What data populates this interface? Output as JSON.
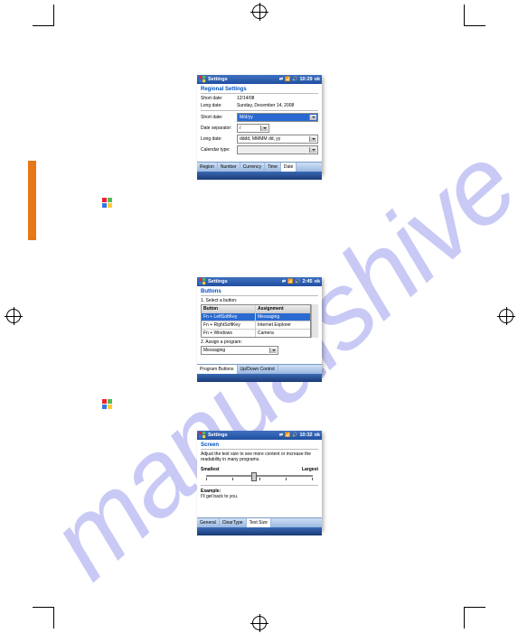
{
  "watermark": "manualshive.com",
  "screenshots": {
    "regional": {
      "title": "Settings",
      "time": "10:29",
      "ok": "ok",
      "panel": "Regional Settings",
      "shortDateLabel": "Short date:",
      "shortDateVal": "12/14/08",
      "longDateLabel": "Long date:",
      "longDateVal": "Sunday, December 14, 2008",
      "shortDateFmtLabel": "Short date:",
      "shortDateFmt": "M/d/yy",
      "separatorLabel": "Date separator:",
      "separatorVal": "/",
      "longDateFmtLabel": "Long date:",
      "longDateFmt": "dddd, MMMM dd, yy",
      "calendarLabel": "Calendar type:",
      "calendarVal": "",
      "tabs": [
        "Region",
        "Number",
        "Currency",
        "Time",
        "Date"
      ],
      "activeTab": 4
    },
    "buttons": {
      "title": "Settings",
      "time": "2:45",
      "ok": "ok",
      "panel": "Buttons",
      "step1": "1. Select a button:",
      "headButton": "Button",
      "headAssign": "Assignment",
      "rows": [
        {
          "b": "Fn + LeftSoftKey",
          "a": "Messaging",
          "sel": true
        },
        {
          "b": "Fn + RightSoftKey",
          "a": "Internet Explorer",
          "sel": false
        },
        {
          "b": "Fn + Windows",
          "a": "Camera",
          "sel": false
        }
      ],
      "step2": "2. Assign a program:",
      "program": "Messaging",
      "tabs": [
        "Program Buttons",
        "Up/Down Control"
      ],
      "activeTab": 0
    },
    "screen": {
      "title": "Settings",
      "time": "10:32",
      "ok": "ok",
      "panel": "Screen",
      "instruction": "Adjust the text size to see more content or increase the readability in many programs.",
      "smallest": "Smallest",
      "largest": "Largest",
      "example": "Example:",
      "exampleText": "I'll get back to you.",
      "tabs": [
        "General",
        "ClearType",
        "Text Size"
      ],
      "activeTab": 2
    }
  }
}
